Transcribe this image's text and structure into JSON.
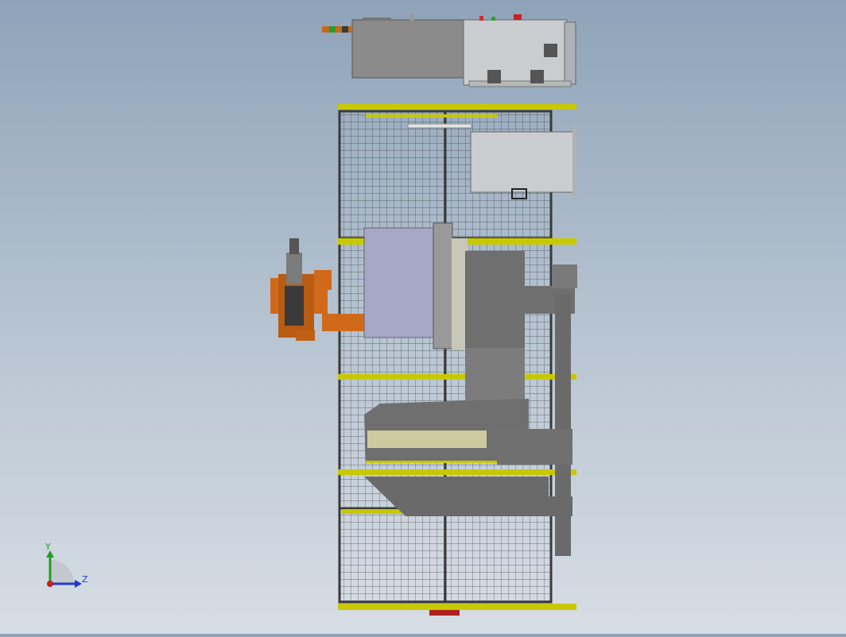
{
  "viewport": {
    "background_top": "#8fa3b8",
    "background_bottom": "#d7dde4"
  },
  "triad": {
    "y_label": "Y",
    "z_label": "Z",
    "y_color": "#1ea01e",
    "z_color": "#2638c8",
    "x_color": "#c81e1e"
  },
  "colors": {
    "fence_frame": "#3a3a3a",
    "fence_rail": "#c8c800",
    "cabinet": "#8a8a8a",
    "panel": "#c9cdd0",
    "robot": "#d06a1a",
    "fixture": "#6f6f6f",
    "tool_face": "#a7a7c8",
    "ring": "#d8d4a4"
  }
}
